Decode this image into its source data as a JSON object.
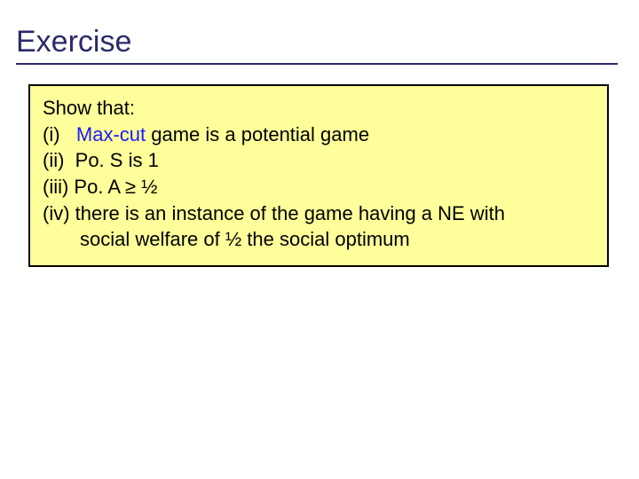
{
  "title": "Exercise",
  "box": {
    "intro": "Show that:",
    "i_prefix": "(i)   ",
    "i_blue": "Max-cut",
    "i_rest": " game is a potential game",
    "ii": "(ii)  Po. S is 1",
    "iii": "(iii) Po. A ≥ ½",
    "iv": "(iv) there is an instance of the game having a NE with",
    "iv_cont": "social welfare of ½ the social optimum"
  }
}
